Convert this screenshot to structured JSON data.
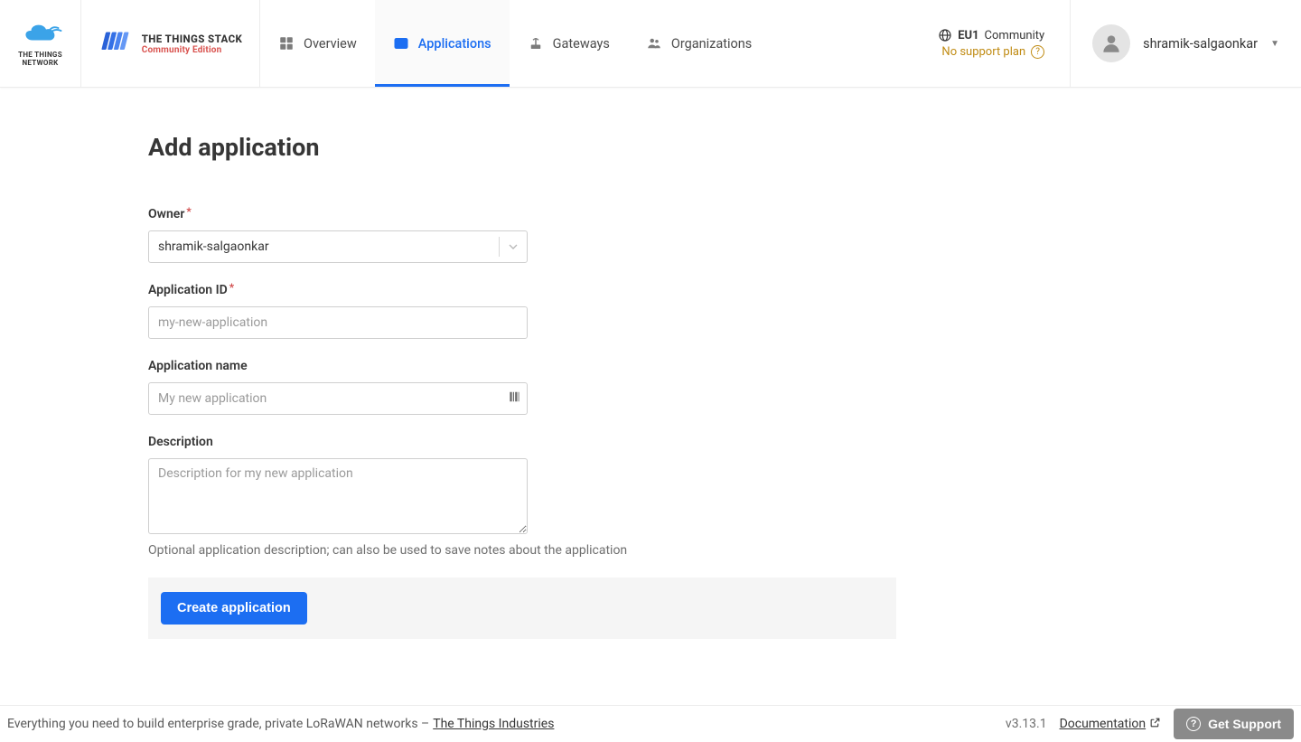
{
  "header": {
    "ttn_logo_label": "THE THINGS NETWORK",
    "stack_logo_line1": "THE THINGS STACK",
    "stack_logo_line2": "Community Edition",
    "nav": {
      "overview": "Overview",
      "applications": "Applications",
      "gateways": "Gateways",
      "organizations": "Organizations"
    },
    "cluster": {
      "region": "EU1",
      "tier": "Community",
      "support": "No support plan"
    },
    "user": {
      "name": "shramik-salgaonkar"
    }
  },
  "page": {
    "title": "Add application"
  },
  "form": {
    "owner": {
      "label": "Owner",
      "value": "shramik-salgaonkar"
    },
    "app_id": {
      "label": "Application ID",
      "placeholder": "my-new-application",
      "value": ""
    },
    "app_name": {
      "label": "Application name",
      "placeholder": "My new application",
      "value": ""
    },
    "description": {
      "label": "Description",
      "placeholder": "Description for my new application",
      "value": "",
      "help": "Optional application description; can also be used to save notes about the application"
    },
    "submit_label": "Create application"
  },
  "footer": {
    "tagline_prefix": "Everything you need to build enterprise grade, private LoRaWAN networks – ",
    "tagline_link": "The Things Industries",
    "version": "v3.13.1",
    "doc_label": "Documentation",
    "support_label": "Get Support"
  }
}
